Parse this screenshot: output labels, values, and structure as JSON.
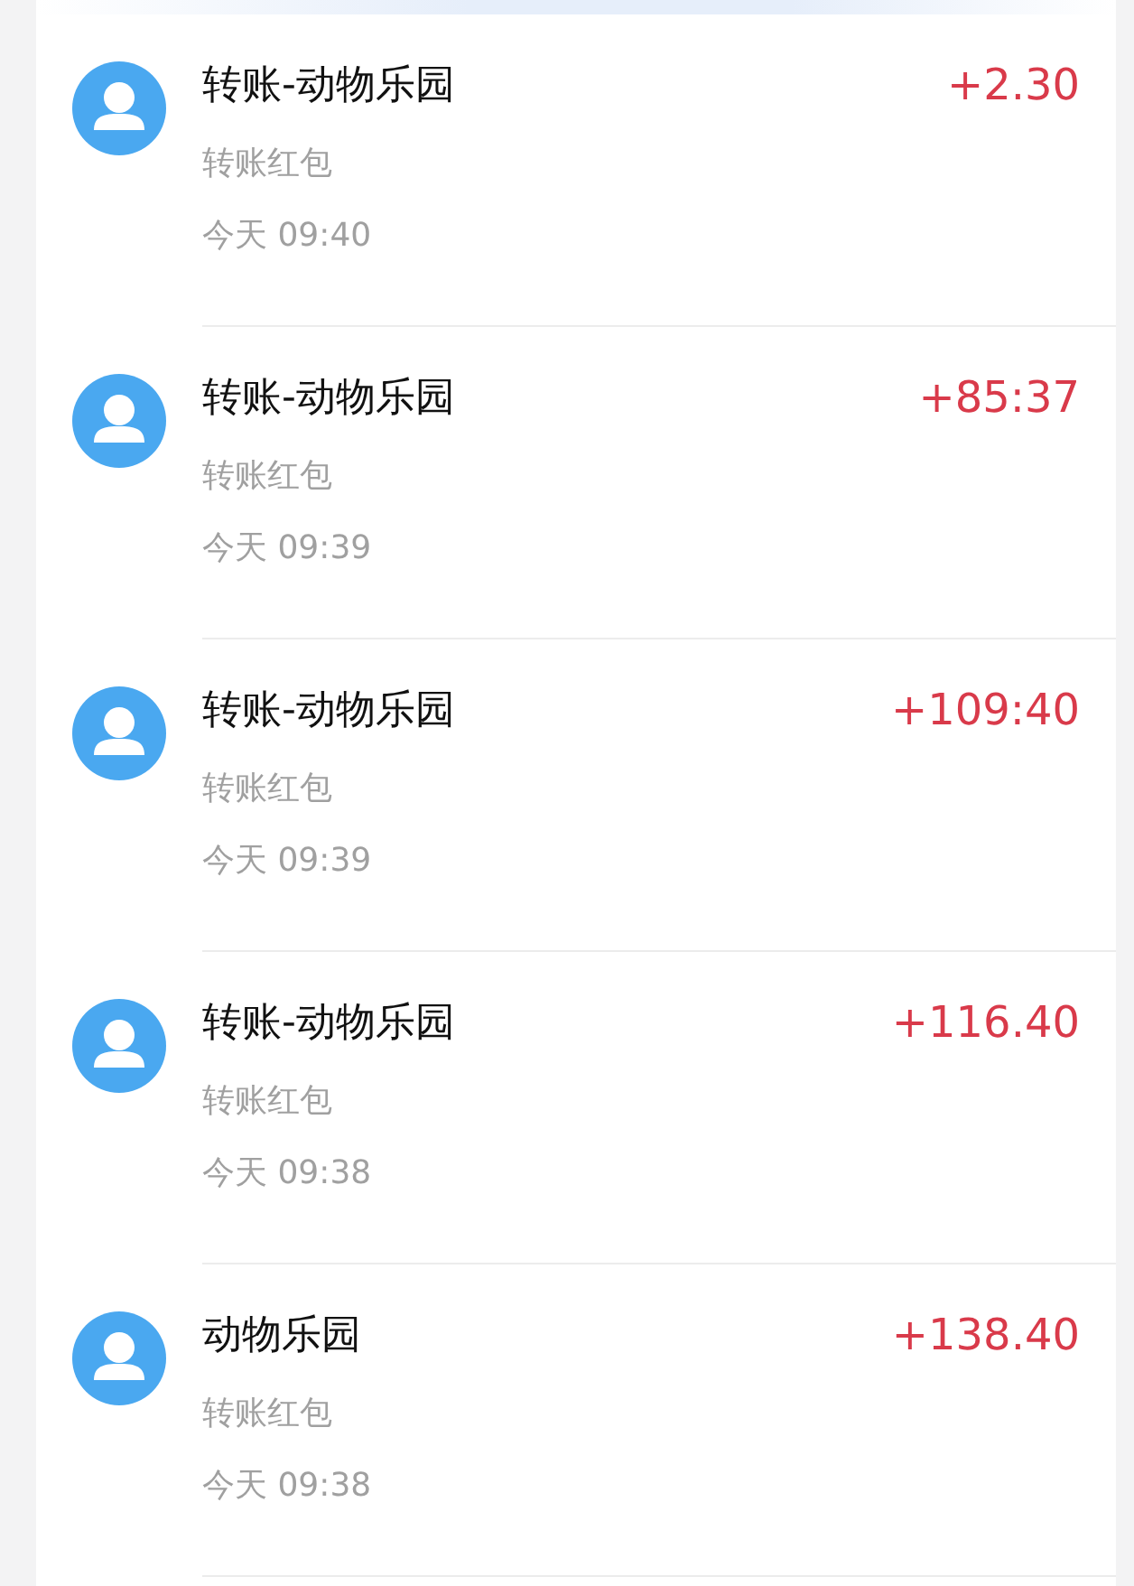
{
  "transactions": [
    {
      "title": "转账-动物乐园",
      "subtitle": "转账红包",
      "time": "今天 09:40",
      "amount": "+2.30"
    },
    {
      "title": "转账-动物乐园",
      "subtitle": "转账红包",
      "time": "今天 09:39",
      "amount": "+85:37"
    },
    {
      "title": "转账-动物乐园",
      "subtitle": "转账红包",
      "time": "今天 09:39",
      "amount": "+109:40"
    },
    {
      "title": "转账-动物乐园",
      "subtitle": "转账红包",
      "time": "今天 09:38",
      "amount": "+116.40"
    },
    {
      "title": "动物乐园",
      "subtitle": "转账红包",
      "time": "今天 09:38",
      "amount": "+138.40"
    }
  ]
}
